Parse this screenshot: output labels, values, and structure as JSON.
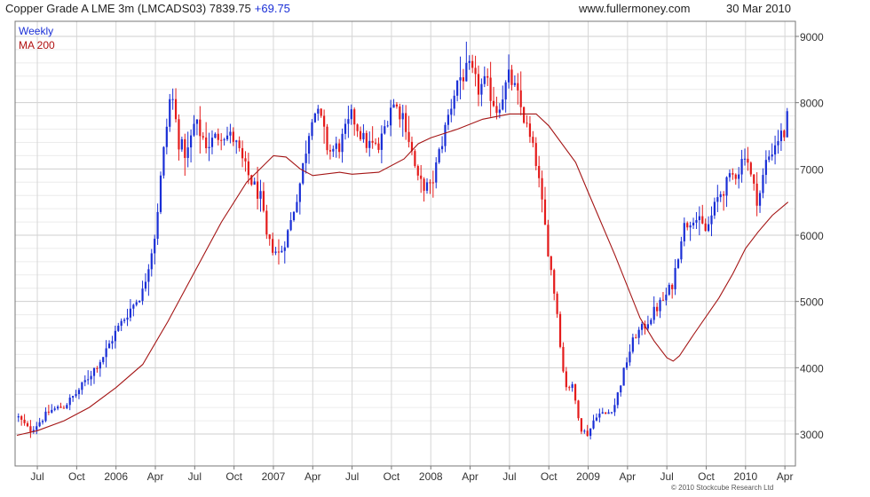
{
  "header": {
    "instrument": "Copper Grade A LME 3m (LMCADS03)",
    "last": "7839.75",
    "change": "+69.75",
    "site": "www.fullermoney.com",
    "date": "30 Mar 2010"
  },
  "footer": {
    "copyright": "© 2010 Stockcube Research Ltd"
  },
  "colors": {
    "up": "#1a2fd6",
    "down": "#e41b1b",
    "ma": "#a41515",
    "grid": "#d6d6d6"
  },
  "chart_data": {
    "type": "candlestick",
    "period": "weekly",
    "legend": [
      "Weekly",
      "MA 200"
    ],
    "legend_placement": "top-left",
    "y_axis_side": "right",
    "grid": true,
    "ylim": [
      2550,
      9100
    ],
    "y_ticks": [
      3000,
      4000,
      5000,
      6000,
      7000,
      8000,
      9000
    ],
    "xlim": [
      2005.37,
      2010.3
    ],
    "x_ticks": [
      {
        "label": "Jul",
        "t": 2005.5
      },
      {
        "label": "Oct",
        "t": 2005.75
      },
      {
        "label": "2006",
        "t": 2006.0
      },
      {
        "label": "Apr",
        "t": 2006.25
      },
      {
        "label": "Jul",
        "t": 2006.5
      },
      {
        "label": "Oct",
        "t": 2006.75
      },
      {
        "label": "2007",
        "t": 2007.0
      },
      {
        "label": "Apr",
        "t": 2007.25
      },
      {
        "label": "Jul",
        "t": 2007.5
      },
      {
        "label": "Oct",
        "t": 2007.75
      },
      {
        "label": "2008",
        "t": 2008.0
      },
      {
        "label": "Apr",
        "t": 2008.25
      },
      {
        "label": "Jul",
        "t": 2008.5
      },
      {
        "label": "Oct",
        "t": 2008.75
      },
      {
        "label": "2009",
        "t": 2009.0
      },
      {
        "label": "Apr",
        "t": 2009.25
      },
      {
        "label": "Jul",
        "t": 2009.5
      },
      {
        "label": "Oct",
        "t": 2009.75
      },
      {
        "label": "2010",
        "t": 2010.0
      },
      {
        "label": "Apr",
        "t": 2010.25
      }
    ],
    "price_path": [
      [
        2005.38,
        3250
      ],
      [
        2005.45,
        3050
      ],
      [
        2005.5,
        3150
      ],
      [
        2005.58,
        3350
      ],
      [
        2005.67,
        3420
      ],
      [
        2005.75,
        3620
      ],
      [
        2005.83,
        3880
      ],
      [
        2005.92,
        4180
      ],
      [
        2006.0,
        4550
      ],
      [
        2006.08,
        4850
      ],
      [
        2006.17,
        5150
      ],
      [
        2006.25,
        6050
      ],
      [
        2006.29,
        7000
      ],
      [
        2006.35,
        8200
      ],
      [
        2006.4,
        7400
      ],
      [
        2006.45,
        7200
      ],
      [
        2006.5,
        7700
      ],
      [
        2006.58,
        7350
      ],
      [
        2006.67,
        7550
      ],
      [
        2006.75,
        7450
      ],
      [
        2006.83,
        6950
      ],
      [
        2006.92,
        6550
      ],
      [
        2006.96,
        5900
      ],
      [
        2007.04,
        5700
      ],
      [
        2007.1,
        6100
      ],
      [
        2007.17,
        6800
      ],
      [
        2007.25,
        7900
      ],
      [
        2007.3,
        7750
      ],
      [
        2007.35,
        7250
      ],
      [
        2007.42,
        7350
      ],
      [
        2007.5,
        7800
      ],
      [
        2007.58,
        7400
      ],
      [
        2007.67,
        7300
      ],
      [
        2007.75,
        8000
      ],
      [
        2007.83,
        7800
      ],
      [
        2007.92,
        6800
      ],
      [
        2008.0,
        6700
      ],
      [
        2008.08,
        7500
      ],
      [
        2008.17,
        8350
      ],
      [
        2008.25,
        8500
      ],
      [
        2008.3,
        8200
      ],
      [
        2008.35,
        8300
      ],
      [
        2008.42,
        7900
      ],
      [
        2008.5,
        8400
      ],
      [
        2008.55,
        8100
      ],
      [
        2008.6,
        7700
      ],
      [
        2008.67,
        7100
      ],
      [
        2008.75,
        5700
      ],
      [
        2008.8,
        4900
      ],
      [
        2008.85,
        3750
      ],
      [
        2008.9,
        3700
      ],
      [
        2008.96,
        3050
      ],
      [
        2009.0,
        3000
      ],
      [
        2009.05,
        3300
      ],
      [
        2009.12,
        3300
      ],
      [
        2009.17,
        3450
      ],
      [
        2009.25,
        4150
      ],
      [
        2009.3,
        4500
      ],
      [
        2009.35,
        4600
      ],
      [
        2009.42,
        4850
      ],
      [
        2009.5,
        5100
      ],
      [
        2009.54,
        5300
      ],
      [
        2009.6,
        6100
      ],
      [
        2009.67,
        6300
      ],
      [
        2009.75,
        6050
      ],
      [
        2009.83,
        6600
      ],
      [
        2009.92,
        6900
      ],
      [
        2009.96,
        7000
      ],
      [
        2010.0,
        7300
      ],
      [
        2010.04,
        6800
      ],
      [
        2010.08,
        6500
      ],
      [
        2010.13,
        7100
      ],
      [
        2010.2,
        7450
      ],
      [
        2010.25,
        7550
      ],
      [
        2010.27,
        7840
      ]
    ],
    "ma_path": [
      [
        2005.37,
        2980
      ],
      [
        2005.5,
        3050
      ],
      [
        2005.67,
        3200
      ],
      [
        2005.83,
        3400
      ],
      [
        2006.0,
        3700
      ],
      [
        2006.17,
        4050
      ],
      [
        2006.33,
        4700
      ],
      [
        2006.5,
        5450
      ],
      [
        2006.67,
        6200
      ],
      [
        2006.83,
        6800
      ],
      [
        2007.0,
        7200
      ],
      [
        2007.08,
        7180
      ],
      [
        2007.17,
        7000
      ],
      [
        2007.25,
        6900
      ],
      [
        2007.42,
        6950
      ],
      [
        2007.5,
        6920
      ],
      [
        2007.67,
        6950
      ],
      [
        2007.83,
        7150
      ],
      [
        2007.92,
        7380
      ],
      [
        2008.0,
        7470
      ],
      [
        2008.17,
        7600
      ],
      [
        2008.33,
        7750
      ],
      [
        2008.5,
        7830
      ],
      [
        2008.67,
        7830
      ],
      [
        2008.75,
        7650
      ],
      [
        2008.92,
        7100
      ],
      [
        2009.0,
        6650
      ],
      [
        2009.17,
        5700
      ],
      [
        2009.33,
        4750
      ],
      [
        2009.42,
        4400
      ],
      [
        2009.5,
        4150
      ],
      [
        2009.54,
        4100
      ],
      [
        2009.58,
        4180
      ],
      [
        2009.67,
        4500
      ],
      [
        2009.83,
        5050
      ],
      [
        2009.92,
        5420
      ],
      [
        2010.0,
        5800
      ],
      [
        2010.08,
        6050
      ],
      [
        2010.17,
        6300
      ],
      [
        2010.27,
        6500
      ]
    ]
  }
}
